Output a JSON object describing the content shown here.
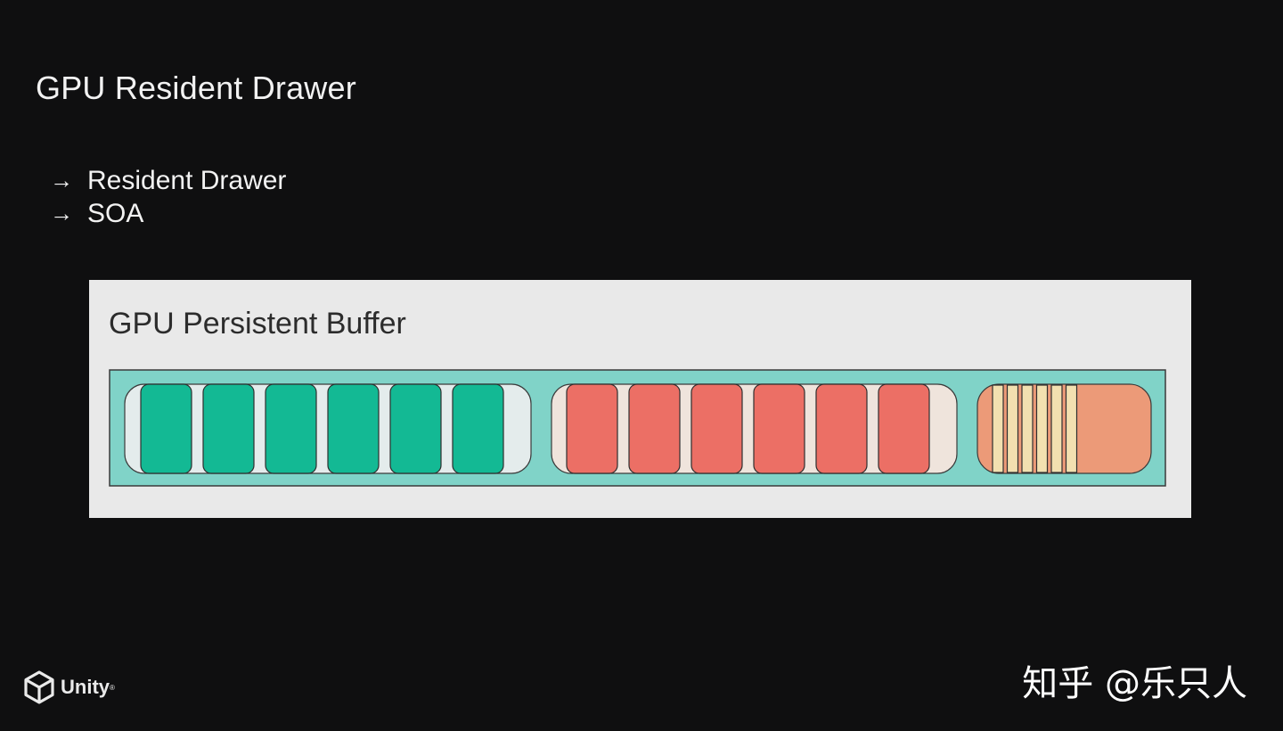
{
  "slide": {
    "title": "GPU Resident Drawer",
    "bullets": [
      "Resident Drawer",
      "SOA"
    ],
    "bullet_arrow": "→"
  },
  "diagram": {
    "panel_title": "GPU Persistent Buffer",
    "groups": [
      {
        "name": "group-green",
        "item_count": 6,
        "item_color": "#13b994",
        "bg_color": "#e4ecec"
      },
      {
        "name": "group-red",
        "item_count": 6,
        "item_color": "#ec6f65",
        "bg_color": "#efe4dc"
      },
      {
        "name": "group-orange",
        "stripe_count": 6,
        "stripe_color": "#f2e0b0",
        "fill_color": "#ec9a78"
      }
    ],
    "buffer_color": "#80d3c8",
    "panel_color": "#e9e9e9"
  },
  "branding": {
    "logo_text": "Unity",
    "logo_reg": "®",
    "watermark": "知乎 @乐只人"
  }
}
